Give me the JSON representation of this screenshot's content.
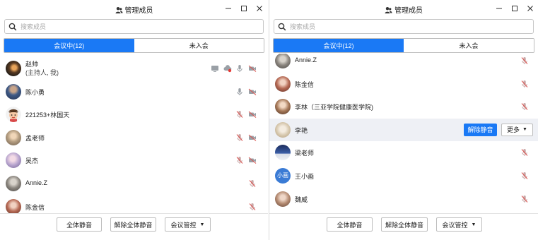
{
  "window": {
    "title": "管理成员"
  },
  "search": {
    "placeholder": "搜索成员"
  },
  "tabs": {
    "in_meeting": "会议中(12)",
    "not_joined": "未入会"
  },
  "left_members": [
    {
      "name": "赵帅",
      "role": "(主持人, 我)"
    },
    {
      "name": "陈小勇"
    },
    {
      "name": "221253+林国天"
    },
    {
      "name": "孟老师"
    },
    {
      "name": "吴杰"
    },
    {
      "name": "Annie.Z"
    },
    {
      "name": "陈金信"
    }
  ],
  "right_members": [
    {
      "name": "Annie.Z"
    },
    {
      "name": "陈金信"
    },
    {
      "name": "李林（三亚学院健康医学院)"
    },
    {
      "name": "李艳"
    },
    {
      "name": "梁老师"
    },
    {
      "name": "王小画",
      "avatar_text": "小画"
    },
    {
      "name": "魏威"
    }
  ],
  "row_actions": {
    "unmute": "解除静音",
    "more": "更多"
  },
  "footer": {
    "mute_all": "全体静音",
    "unmute_all": "解除全体静音",
    "controls": "会议管控"
  },
  "colors": {
    "accent": "#1a79f5",
    "muted_mic": "#d9534f",
    "icon_gray": "#9aa0a6"
  }
}
